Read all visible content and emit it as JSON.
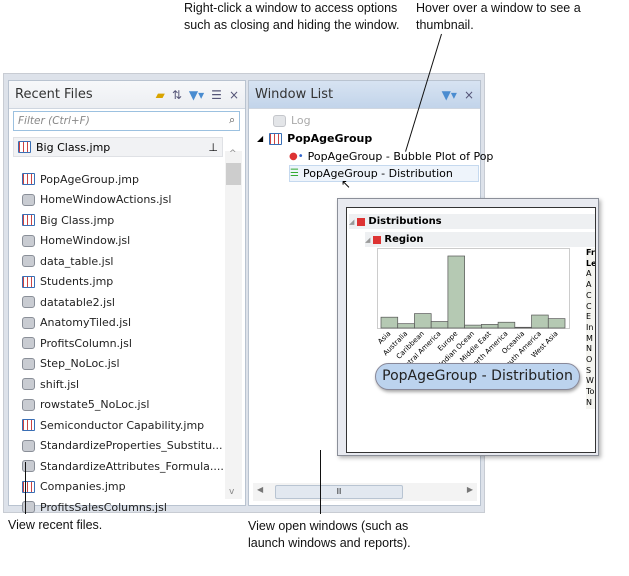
{
  "annotations": {
    "right_click": "Right-click a window to access options such as closing and hiding the window.",
    "hover": "Hover over a window to see a thumbnail.",
    "recent": "View recent files.",
    "open_windows": "View open windows (such as launch windows and reports)."
  },
  "recent_files": {
    "title": "Recent Files",
    "filter_placeholder": "Filter (Ctrl+F)",
    "pinned": "Big Class.jmp",
    "items": [
      {
        "label": "PopAgeGroup.jmp",
        "type": "jmp"
      },
      {
        "label": "HomeWindowActions.jsl",
        "type": "jsl"
      },
      {
        "label": "Big Class.jmp",
        "type": "jmp"
      },
      {
        "label": "HomeWindow.jsl",
        "type": "jsl"
      },
      {
        "label": "data_table.jsl",
        "type": "jsl"
      },
      {
        "label": "Students.jmp",
        "type": "jmp"
      },
      {
        "label": "datatable2.jsl",
        "type": "jsl"
      },
      {
        "label": "AnatomyTiled.jsl",
        "type": "jsl"
      },
      {
        "label": "ProfitsColumn.jsl",
        "type": "jsl"
      },
      {
        "label": "Step_NoLoc.jsl",
        "type": "jsl"
      },
      {
        "label": "shift.jsl",
        "type": "jsl"
      },
      {
        "label": "rowstate5_NoLoc.jsl",
        "type": "jsl"
      },
      {
        "label": "Semiconductor Capability.jmp",
        "type": "jmp"
      },
      {
        "label": "StandardizeProperties_Substitu...",
        "type": "jsl"
      },
      {
        "label": "StandardizeAttributes_Formula....",
        "type": "jsl"
      },
      {
        "label": "Companies.jmp",
        "type": "jmp"
      },
      {
        "label": "ProfitsSalesColumns.jsl",
        "type": "jsl"
      }
    ]
  },
  "window_list": {
    "title": "Window List",
    "log": "Log",
    "group": "PopAgeGroup",
    "children": [
      "PopAgeGroup - Bubble Plot of Pop",
      "PopAgeGroup - Distribution"
    ]
  },
  "thumbnail": {
    "distributions": "Distributions",
    "region": "Region",
    "freq_header": "Fr",
    "freq_col": "Le",
    "freq_rows": [
      "A",
      "A",
      "C",
      "C",
      "E",
      "In",
      "M",
      "N",
      "O",
      "S",
      "W",
      "To",
      "N"
    ],
    "tooltip": "PopAgeGroup - Distribution",
    "chart_data": {
      "type": "bar",
      "categories": [
        "Asia",
        "Australia",
        "Caribbean",
        "Central America",
        "Europe",
        "Indian Ocean",
        "Middle East",
        "North America",
        "Oceania",
        "South America",
        "West Asia"
      ],
      "values": [
        15,
        6,
        20,
        9,
        100,
        4,
        5,
        8,
        1,
        18,
        13
      ]
    },
    "bar_color": "#b5c9b3"
  }
}
